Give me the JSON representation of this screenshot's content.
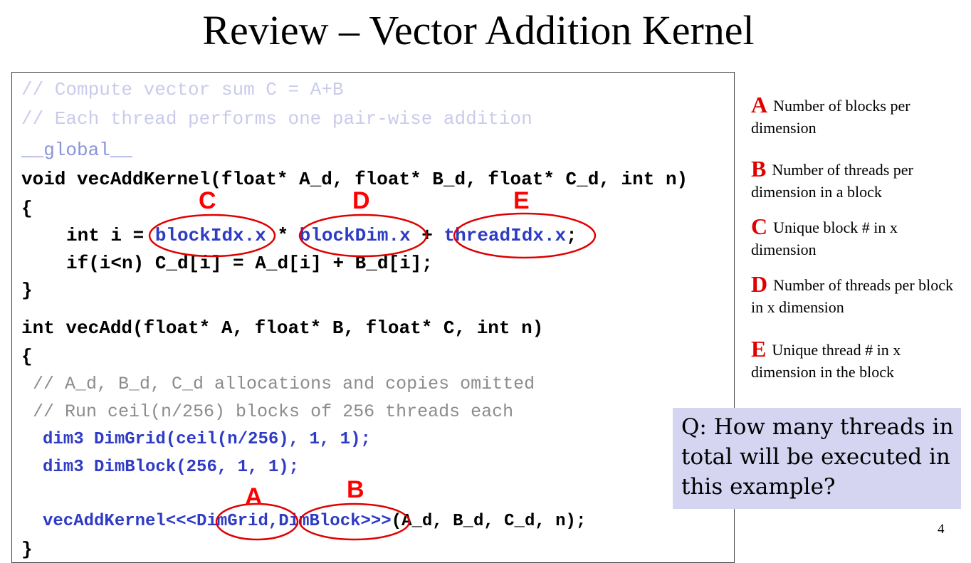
{
  "title": "Review – Vector Addition Kernel",
  "code": {
    "comment_line1": "// Compute vector sum C = A+B",
    "comment_line2": "// Each thread performs one pair-wise addition",
    "global_kw": "__global__",
    "signature": "void vecAddKernel(float* A_d, float* B_d, float* C_d, int n)",
    "open_brace1": "{",
    "line_i_prefix": "int i = ",
    "blockIdx": "blockIdx.x",
    "mult": " * ",
    "blockDim": "blockDim.x",
    "plus": " + ",
    "threadIdx": "threadIdx.x",
    "semicolon": ";",
    "if_line": "if(i<n) C_d[i] = A_d[i] + B_d[i];",
    "close_brace1": "}",
    "host_signature": "int vecAdd(float* A, float* B, float* C, int n)",
    "open_brace2": "{",
    "host_comment1": "// A_d, B_d, C_d allocations and copies omitted",
    "host_comment2": "// Run ceil(n/256) blocks of 256 threads each",
    "dimgrid_line": "dim3 DimGrid(ceil(n/256), 1, 1);",
    "dimblock_line": "dim3 DimBlock(256, 1, 1);",
    "launch_kernel": "vecAddKernel<<<",
    "launch_grid": "DimGrid",
    "launch_comma": ",",
    "launch_block": "DimBlock",
    "launch_close": ">>>",
    "launch_args": "(A_d, B_d, C_d, n);",
    "close_brace2": "}"
  },
  "annotations": {
    "label_A": "A",
    "label_B": "B",
    "label_C": "C",
    "label_D": "D",
    "label_E": "E",
    "ellipse_color": "#e00000"
  },
  "legend": [
    {
      "letter": "A",
      "text": "Number of blocks per dimension"
    },
    {
      "letter": "B",
      "text": "Number of threads per dimension in a block"
    },
    {
      "letter": "C",
      "text": "Unique block # in x dimension"
    },
    {
      "letter": "D",
      "text": "Number of threads per block in x dimension"
    },
    {
      "letter": "E",
      "text": "Unique thread # in x dimension in the block"
    }
  ],
  "question": "Q: How many threads in total will be executed in this example?",
  "page_number": "4"
}
